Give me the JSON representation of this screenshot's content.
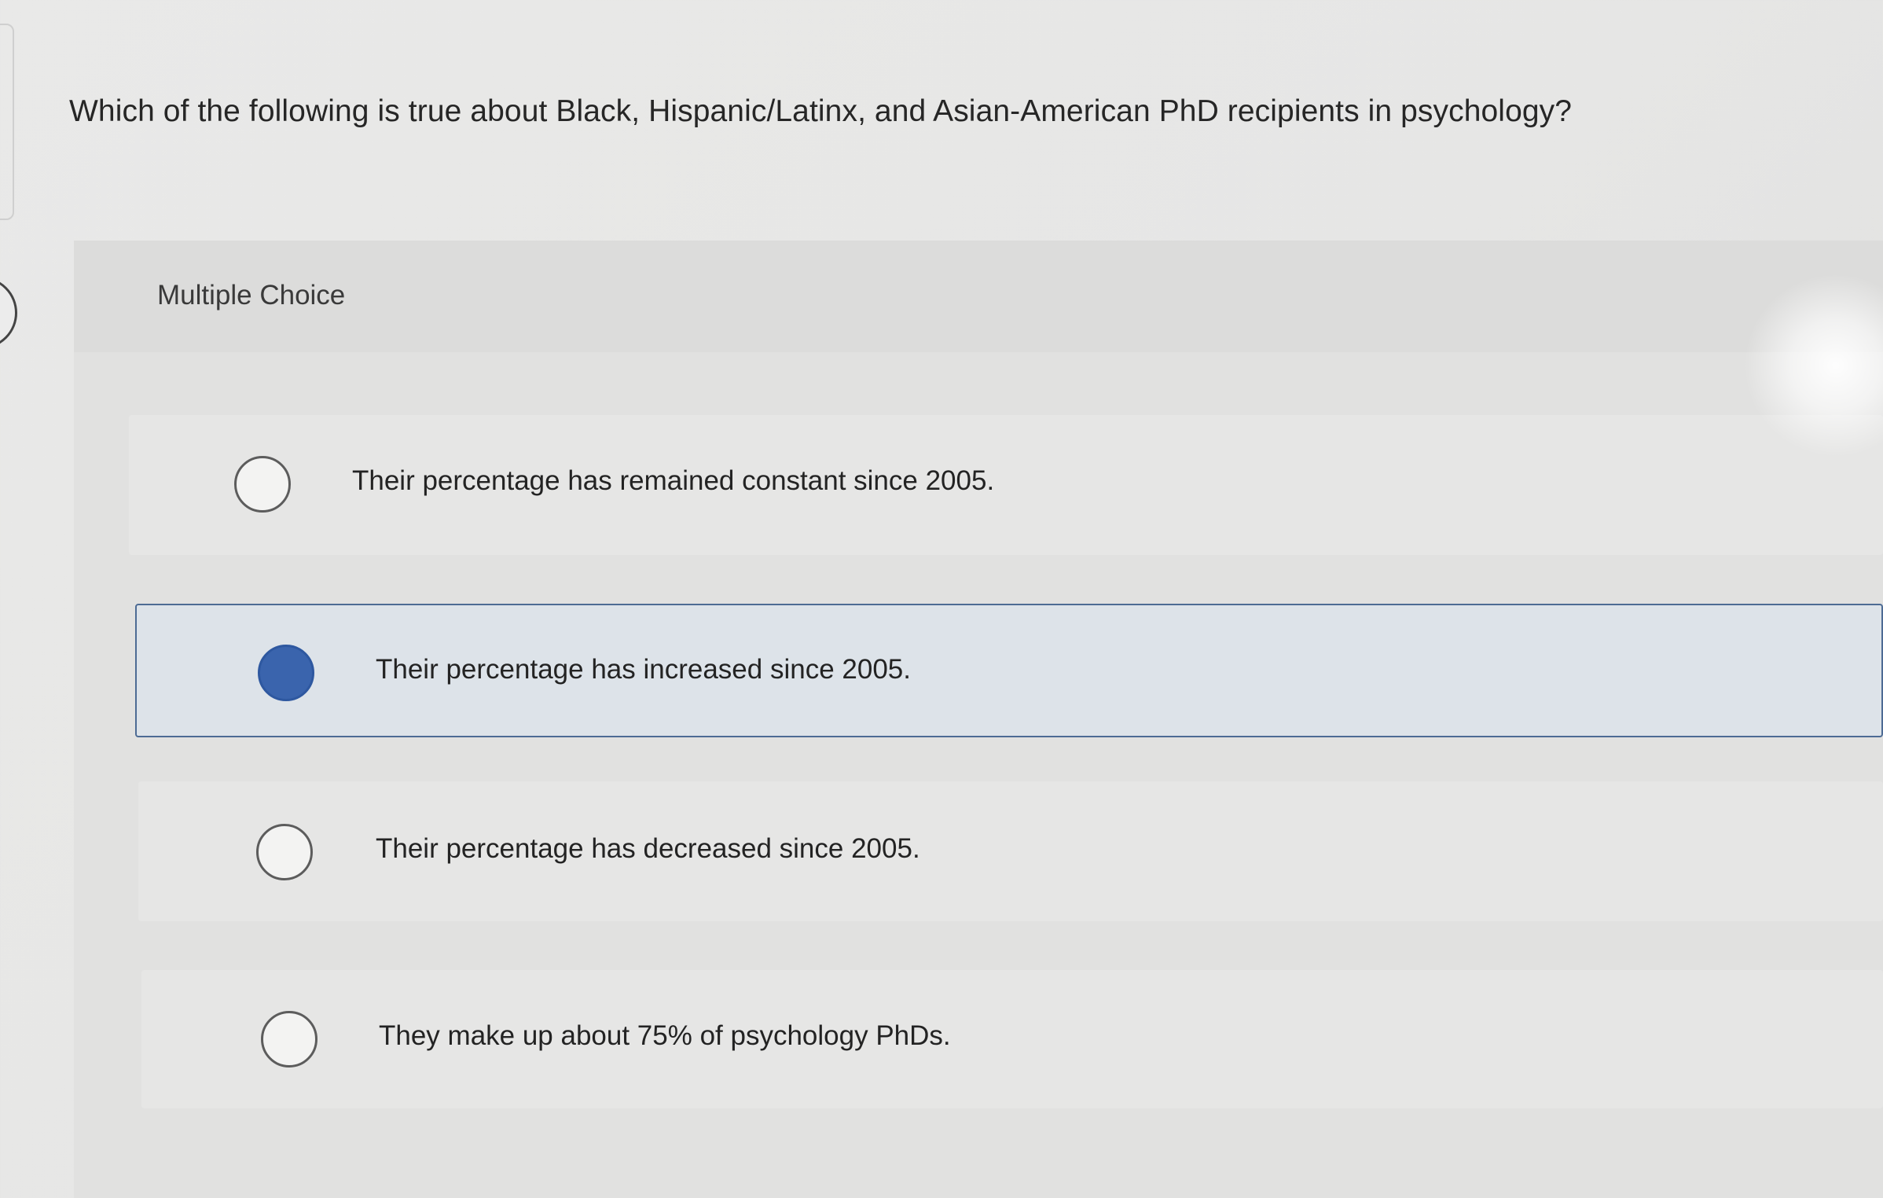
{
  "question": {
    "text": "Which of the following is true about Black, Hispanic/Latinx, and Asian-American PhD recipients in psychology?"
  },
  "multiple_choice": {
    "label": "Multiple Choice",
    "options": [
      {
        "text": "Their percentage has remained constant since 2005.",
        "selected": false
      },
      {
        "text": "Their percentage has increased since 2005.",
        "selected": true
      },
      {
        "text": "Their percentage has decreased since 2005.",
        "selected": false
      },
      {
        "text": "They make up about 75% of psychology PhDs.",
        "selected": false
      }
    ]
  },
  "colors": {
    "selected_radio": "#3a64ad",
    "selected_border": "#4d6b94",
    "selected_background": "#dde3e9"
  }
}
